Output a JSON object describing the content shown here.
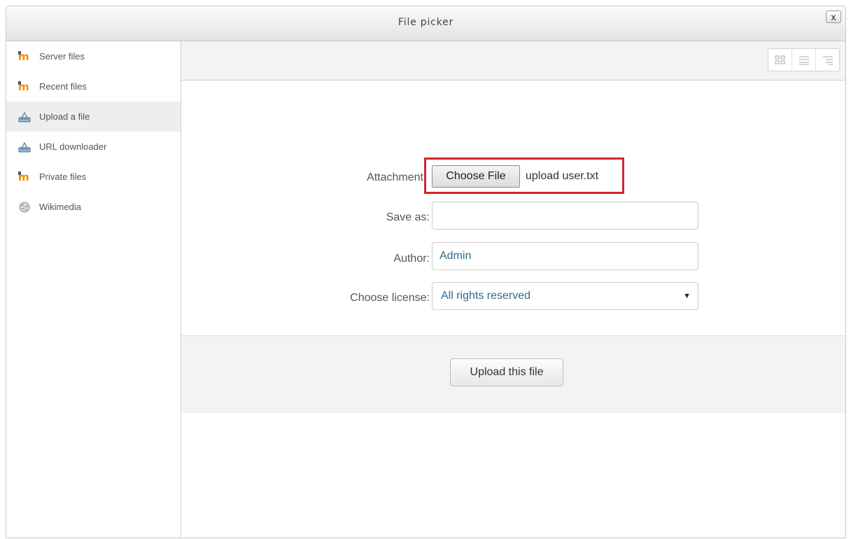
{
  "dialog": {
    "title": "File picker",
    "close_label": "x"
  },
  "sidebar": {
    "items": [
      {
        "label": "Server files",
        "icon": "moodle-icon"
      },
      {
        "label": "Recent files",
        "icon": "moodle-icon"
      },
      {
        "label": "Upload a file",
        "icon": "upload-icon",
        "active": true
      },
      {
        "label": "URL downloader",
        "icon": "upload-icon"
      },
      {
        "label": "Private files",
        "icon": "moodle-icon"
      },
      {
        "label": "Wikimedia",
        "icon": "wikipedia-globe-icon"
      }
    ]
  },
  "toolbar": {
    "view_buttons": [
      "icon-view",
      "list-view",
      "tree-view"
    ]
  },
  "form": {
    "attachment_label": "Attachment",
    "choose_file_label": "Choose File",
    "chosen_file": "upload user.txt",
    "save_as_label": "Save as:",
    "save_as_value": "",
    "author_label": "Author:",
    "author_value": "Admin",
    "license_label": "Choose license:",
    "license_value": "All rights reserved"
  },
  "actions": {
    "upload_label": "Upload this file"
  },
  "colors": {
    "highlight": "#d1262a",
    "moodle_orange": "#f28c00",
    "field_text": "#2e6d8a"
  }
}
